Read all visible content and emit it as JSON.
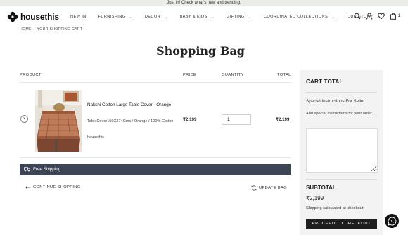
{
  "announcement": "Just in! Check what's new and trending.",
  "brand": {
    "name": "housethis"
  },
  "nav": {
    "items": [
      {
        "label": "NEW IN",
        "has_dropdown": false
      },
      {
        "label": "FURNISHING",
        "has_dropdown": true
      },
      {
        "label": "DECOR",
        "has_dropdown": true
      },
      {
        "label": "BABY & KIDS",
        "has_dropdown": true
      },
      {
        "label": "GIFTING",
        "has_dropdown": true
      },
      {
        "label": "COORDINATED COLLECTIONS",
        "has_dropdown": true
      },
      {
        "label": "OUR STORY",
        "has_dropdown": true
      }
    ]
  },
  "header_icons": [
    "search-icon",
    "account-icon",
    "wishlist-heart-icon",
    "cart-bag-icon"
  ],
  "cart_count": "1",
  "breadcrumb": {
    "home": "HOME",
    "separator": "/",
    "current": "YOUR SHOPPING CART"
  },
  "page_title": "Shopping Bag",
  "table": {
    "headers": {
      "product": "PRODUCT",
      "price": "PRICE",
      "quantity": "QUANTITY",
      "total": "TOTAL"
    },
    "items": [
      {
        "name": "Nakshi Cotton Large Table Cover - Orange",
        "variant": "TableCover150X274Cms / Orange / 100% Cotton",
        "vendor": "housethis",
        "price": "₹2,199",
        "quantity": "1",
        "total": "₹2,199"
      }
    ]
  },
  "free_shipping": "Free Shipping",
  "actions": {
    "continue": "CONTINUE SHOPPING",
    "update": "UPDATE BAG"
  },
  "cart_total": {
    "title": "CART TOTAL",
    "instructions_title": "Special Instructions For Seller",
    "instructions_help": "Add special instructions for your order...",
    "instructions_value": "",
    "subtotal_label": "SUBTOTAL",
    "subtotal_value": "₹2,199",
    "shipping_note": "Shipping calculated at checkout",
    "checkout_label": "PROCEED TO CHECKOUT"
  },
  "colors": {
    "announcement_bg": "#e9ece7",
    "shipping_bar": "#3d4455",
    "sidebar_bg": "#f3f3f3",
    "checkout_button": "#1f1f1f"
  }
}
